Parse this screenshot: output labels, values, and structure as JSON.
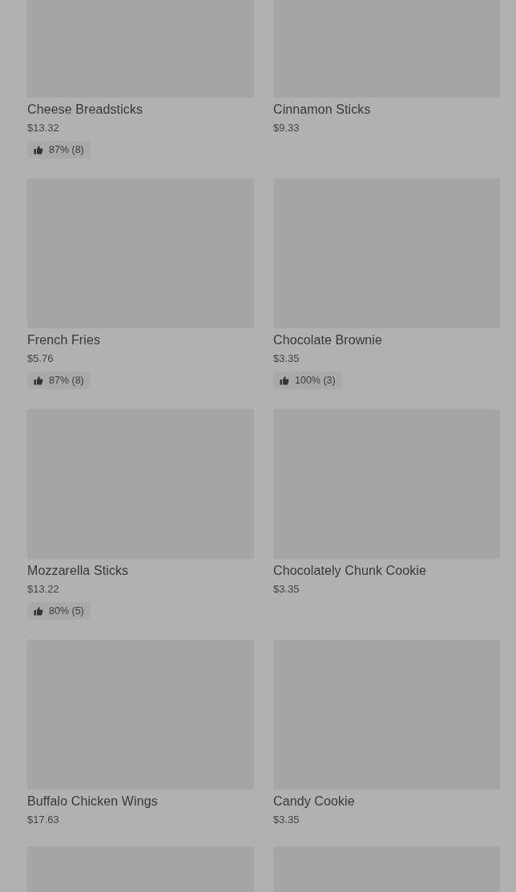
{
  "items": [
    {
      "kind": "product",
      "name": "Cheese Breadsticks",
      "price": "$13.32",
      "rating": "87% (8)"
    },
    {
      "kind": "product",
      "name": "Cinnamon Sticks",
      "price": "$9.33"
    },
    {
      "kind": "product",
      "name": "French Fries",
      "price": "$5.76",
      "rating": "87% (8)"
    },
    {
      "kind": "product",
      "name": "Chocolate Brownie",
      "price": "$3.35",
      "rating": "100% (3)"
    },
    {
      "kind": "product",
      "name": "Mozzarella Sticks",
      "price": "$13.22",
      "rating": "80% (5)"
    },
    {
      "kind": "product",
      "name": "Chocolately Chunk Cookie",
      "price": "$3.35"
    },
    {
      "kind": "product",
      "name": "Buffalo Chicken Wings",
      "price": "$17.63"
    },
    {
      "kind": "product",
      "name": "Candy Cookie",
      "price": "$3.35"
    },
    {
      "kind": "image-only"
    },
    {
      "kind": "image-only"
    }
  ]
}
